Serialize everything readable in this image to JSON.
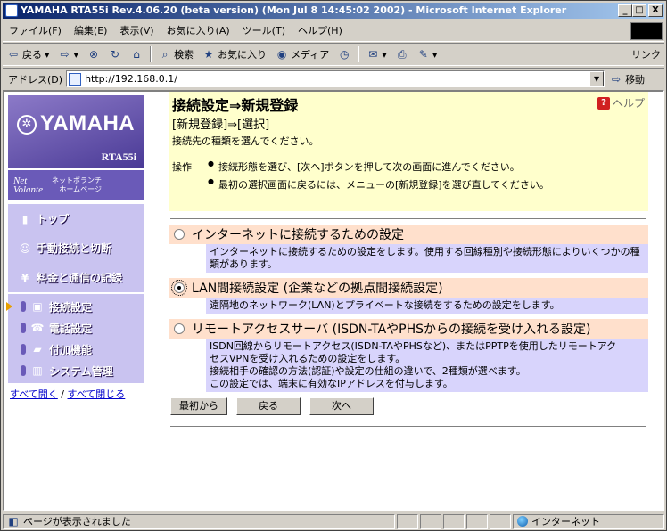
{
  "window": {
    "title": "YAMAHA RTA55i Rev.4.06.20 (beta version) (Mon Jul 8 14:45:02 2002) - Microsoft Internet Explorer",
    "min": "_",
    "max": "□",
    "close": "X"
  },
  "menu": [
    "ファイル(F)",
    "編集(E)",
    "表示(V)",
    "お気に入り(A)",
    "ツール(T)",
    "ヘルプ(H)"
  ],
  "toolbar": {
    "back": "戻る",
    "search": "検索",
    "favorites": "お気に入り",
    "media": "メディア",
    "link": "リンク"
  },
  "address": {
    "label": "アドレス(D)",
    "url": "http://192.168.0.1/",
    "go": "移動"
  },
  "sidebar": {
    "logo_name": "YAMAHA",
    "logo_model": "RTA55i",
    "netvolante_logo_top": "Net",
    "netvolante_logo": "Volante",
    "netvolante_link_1": "ネットボランチ",
    "netvolante_link_2": "ホームページ",
    "nav": [
      {
        "label": "トップ"
      },
      {
        "label": "手動接続と切断"
      },
      {
        "label": "料金と通信の記録"
      }
    ],
    "sub": [
      {
        "label": "接続設定"
      },
      {
        "label": "電話設定"
      },
      {
        "label": "付加機能"
      },
      {
        "label": "システム管理"
      }
    ],
    "expand_all": "すべて開く",
    "divider": "/",
    "collapse_all": "すべて閉じる"
  },
  "main": {
    "title": "接続設定⇒新規登録",
    "subtitle": "[新規登録]⇒[選択]",
    "desc": "接続先の種類を選んでください。",
    "help": "ヘルプ",
    "ops_label": "操作",
    "ops": [
      "接続形態を選び、[次へ]ボタンを押して次の画面に進んでください。",
      "最初の選択画面に戻るには、メニューの[新規登録]を選び直してください。"
    ],
    "options": [
      {
        "label": "インターネットに接続するための設定",
        "desc": "インターネットに接続するための設定をします。使用する回線種別や接続形態によりいくつかの種類があります。",
        "selected": false
      },
      {
        "label": "LAN間接続設定 (企業などの拠点間接続設定)",
        "desc": "遠隔地のネットワーク(LAN)とプライベートな接続をするための設定をします。",
        "selected": true
      },
      {
        "label": "リモートアクセスサーバ (ISDN-TAやPHSからの接続を受け入れる設定)",
        "desc_lines": [
          "ISDN回線からリモートアクセス(ISDN-TAやPHSなど)、またはPPTPを使用したリモートアク",
          "セスVPNを受け入れるための設定をします。",
          "接続相手の確認の方法(認証)や設定の仕組の違いで、2種類が選べます。",
          "この設定では、端末に有効なIPアドレスを付与します。"
        ],
        "selected": false
      }
    ],
    "buttons": {
      "first": "最初から",
      "back": "戻る",
      "next": "次へ"
    }
  },
  "status": {
    "text": "ページが表示されました",
    "zone": "インターネット"
  }
}
